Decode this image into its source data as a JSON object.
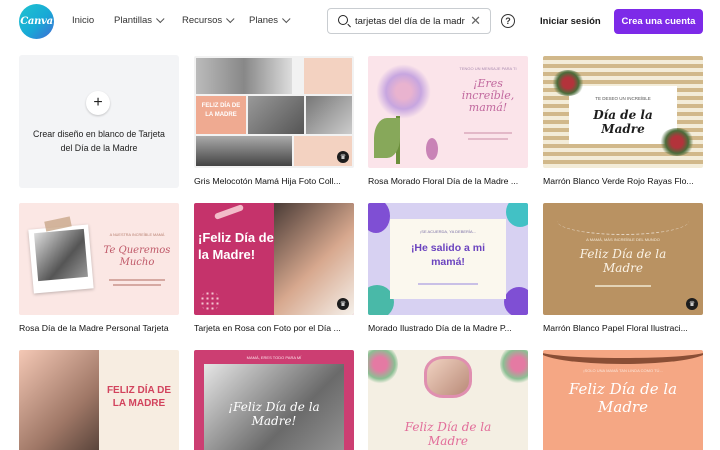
{
  "header": {
    "logo_text": "Canva",
    "nav": [
      {
        "label": "Inicio",
        "has_chevron": false
      },
      {
        "label": "Plantillas",
        "has_chevron": true
      },
      {
        "label": "Recursos",
        "has_chevron": true
      },
      {
        "label": "Planes",
        "has_chevron": true
      }
    ],
    "search_value": "tarjetas del día de la madre",
    "help_symbol": "?",
    "login_label": "Iniciar sesión",
    "signup_label": "Crea una cuenta",
    "brand_color": "#7d2ae8"
  },
  "blank_card": {
    "plus": "+",
    "label": "Crear diseño en blanco de Tarjeta del Día de la Madre"
  },
  "templates": [
    {
      "caption": "Gris Melocotón Mamá Hija Foto Coll...",
      "thumb_text": "FELIZ DÍA DE LA MADRE",
      "pro": true
    },
    {
      "caption": "Rosa Morado Floral Día de la Madre ...",
      "thumb_text": "¡Eres increíble, mamá!",
      "thumb_small": "TENGO UN MENSAJE PARA TI",
      "pro": false
    },
    {
      "caption": "Marrón Blanco Verde Rojo Rayas Flo...",
      "thumb_text": "Día de la Madre",
      "thumb_small": "TE DESEO UN INCREÍBLE",
      "pro": false
    },
    {
      "caption": "Rosa Día de la Madre Personal Tarjeta",
      "thumb_text": "Te Queremos Mucho",
      "thumb_small": "A NUESTRA INCREÍBLE MAMÁ",
      "pro": false
    },
    {
      "caption": "Tarjeta en Rosa con Foto por el Día ...",
      "thumb_text": "¡Feliz Día de la Madre!",
      "pro": true
    },
    {
      "caption": "Morado Ilustrado Día de la Madre P...",
      "thumb_text": "¡He salido a mi mamá!",
      "thumb_small": "¡SE ACUERDA, YA DEBERÍA...",
      "pro": false
    },
    {
      "caption": "Marrón Blanco Papel Floral Ilustraci...",
      "thumb_text": "Feliz Día de la Madre",
      "thumb_small": "A MAMÁ, MÁS INCREÍBLE DEL MUNDO",
      "pro": true
    },
    {
      "caption": "",
      "thumb_text": "FELIZ DÍA DE LA MADRE",
      "pro": false
    },
    {
      "caption": "",
      "thumb_text": "¡Feliz Día de la Madre!",
      "thumb_small": "MAMÁ, ERES TODO PARA MÍ",
      "pro": false
    },
    {
      "caption": "",
      "thumb_text": "Feliz Día de la Madre",
      "pro": false
    },
    {
      "caption": "",
      "thumb_text": "Feliz Día de la Madre",
      "thumb_small": "¡SOLO UNA MAMÁ TAN LINDA COMO TÚ...",
      "pro": false
    }
  ]
}
